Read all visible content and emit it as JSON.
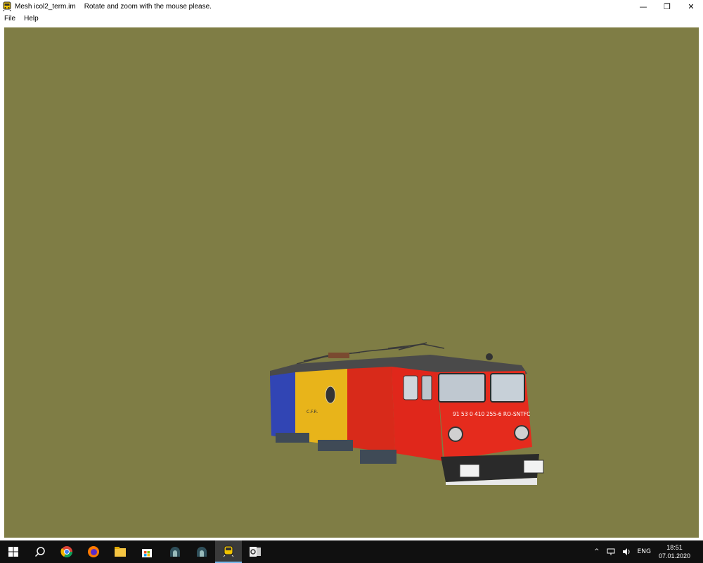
{
  "window": {
    "title": "Mesh icol2_term.im",
    "hint": "Rotate and zoom with the mouse please.",
    "minimize_glyph": "—",
    "restore_glyph": "❐",
    "close_glyph": "✕"
  },
  "menu": {
    "items": [
      {
        "label": "File"
      },
      {
        "label": "Help"
      }
    ]
  },
  "viewport": {
    "background_color": "#7f7d45",
    "locomotive_number": "91 53 0 410 255-6 RO-SNTFC"
  },
  "taskbar": {
    "icons": [
      "windows-start-icon",
      "search-icon",
      "chrome-icon",
      "firefox-icon",
      "file-explorer-icon",
      "store-icon",
      "app-icon",
      "app-icon",
      "train-app-icon",
      "outlook-icon"
    ],
    "tray": {
      "chevron": "^",
      "language": "ENG",
      "time": "18:51",
      "date": "07.01.2020"
    }
  }
}
